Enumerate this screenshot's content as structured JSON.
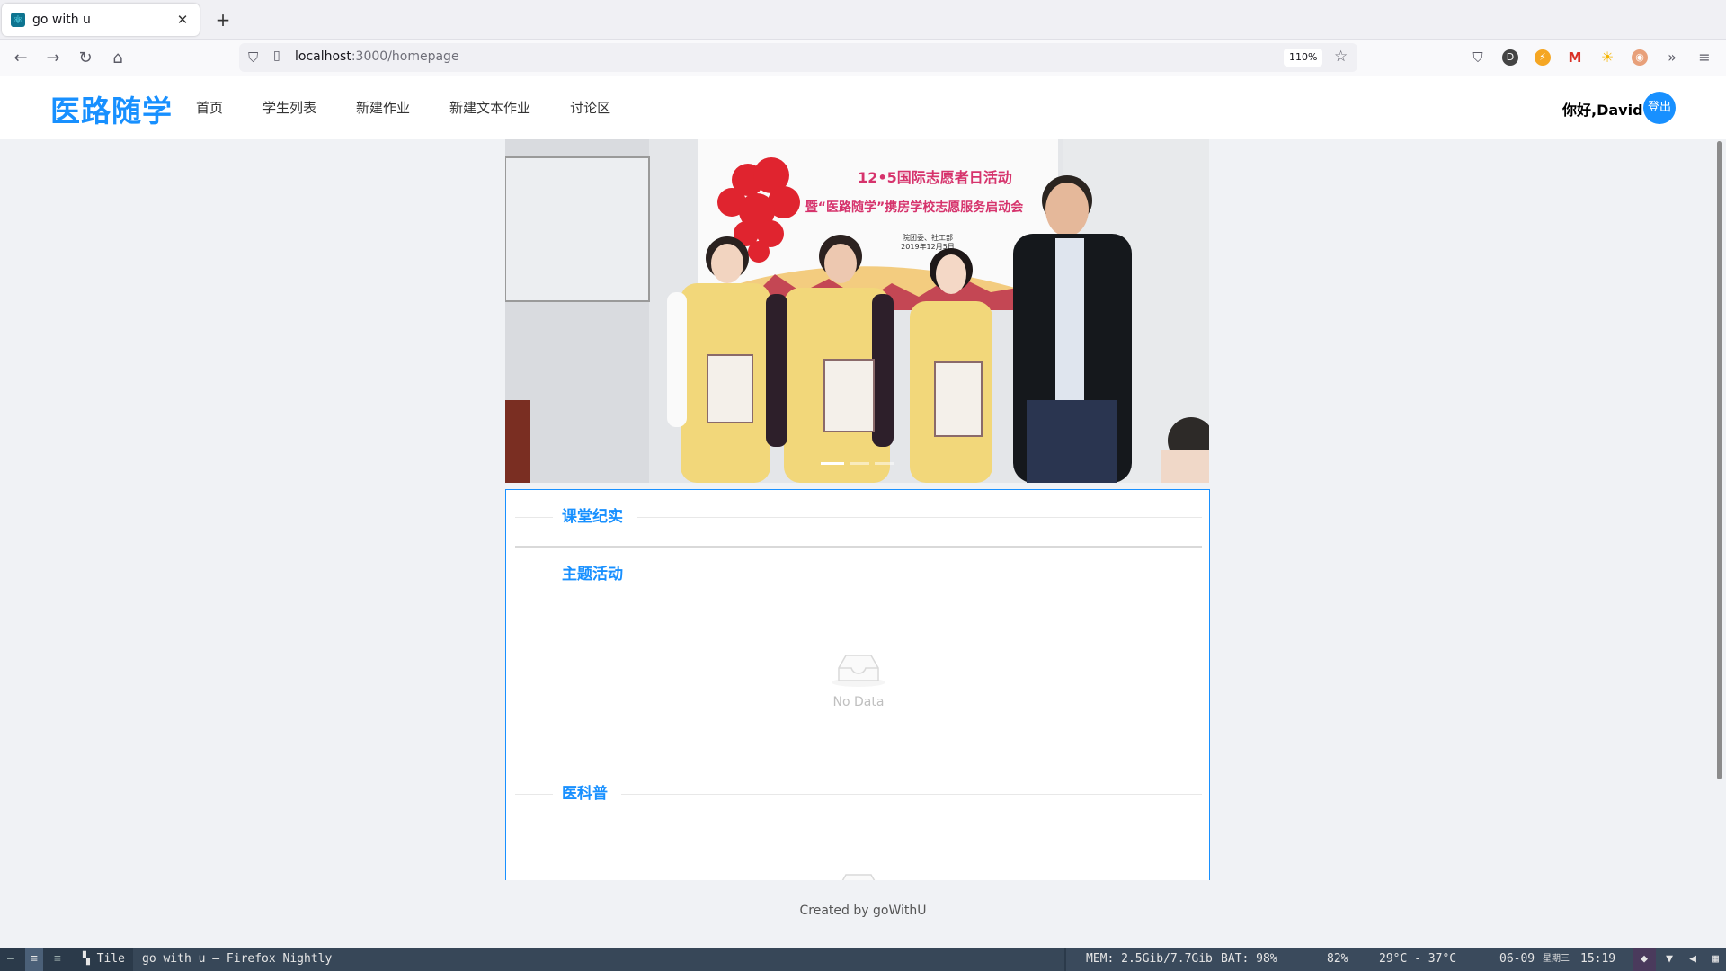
{
  "browser": {
    "tab_title": "go with u",
    "url_host": "localhost",
    "url_path": ":3000/homepage",
    "zoom": "110%"
  },
  "header": {
    "logo": "医路随学",
    "menu": [
      "首页",
      "学生列表",
      "新建作业",
      "新建文本作业",
      "讨论区"
    ],
    "greeting": "你好,David",
    "logout": "登出"
  },
  "carousel": {
    "banner_line1": "12•5国际志愿者日活动",
    "banner_line2": "暨“医路随学”携房学校志愿服务启动会",
    "banner_line3": "院团委、社工部",
    "banner_line4": "2019年12月5日",
    "active_slide": 1,
    "slide_count": 3
  },
  "sections": [
    {
      "title": "课堂纪实"
    },
    {
      "title": "主题活动",
      "empty_text": "No Data"
    },
    {
      "title": "医科普"
    }
  ],
  "footer": "Created by goWithU",
  "taskbar": {
    "layout": "Tile",
    "window_title": "go with u — Firefox Nightly",
    "mem": "MEM: 2.5Gib/7.7Gib",
    "bat": "BAT: 98%",
    "vol": "82%",
    "temp": "29°C - 37°C",
    "date": "06-09",
    "weekday": "星期三",
    "time": "15:19"
  },
  "colors": {
    "accent": "#1890ff"
  }
}
